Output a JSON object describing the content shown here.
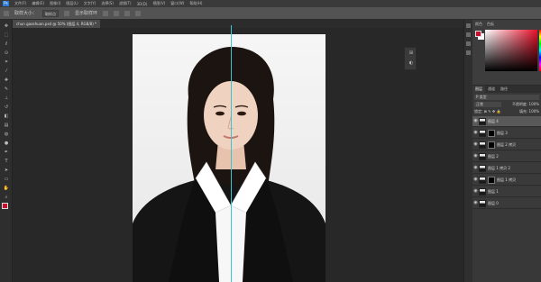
{
  "menu": {
    "logo": "Ps",
    "items": [
      "文件(F)",
      "编辑(E)",
      "图像(I)",
      "图层(L)",
      "文字(Y)",
      "选择(S)",
      "滤镜(T)",
      "3D(D)",
      "视图(V)",
      "窗口(W)",
      "帮助(H)"
    ]
  },
  "options": {
    "sample": "取样大小：",
    "sample_value": "取样点",
    "show_ring": "显示取样环"
  },
  "tabs": [
    {
      "label": "chun gaoshuan.psd @ 50% (图层 4, RGB/8) *",
      "active": true
    }
  ],
  "color_panel": {
    "tabs": [
      "颜色",
      "色板"
    ],
    "fg_color": "#c8102e",
    "bg_color": "#ffffff"
  },
  "layers_panel": {
    "tabs": [
      "图层",
      "通道",
      "路径"
    ],
    "filter": "P 类型",
    "blend_mode": "正常",
    "opacity": "不透明度: 100%",
    "lock": "锁定: ⊠ ✎ ✥ 🔒",
    "fill": "填充: 100%",
    "rows": [
      {
        "name": "图层 4",
        "mask": false,
        "active": true
      },
      {
        "name": "图层 3",
        "mask": true,
        "active": false
      },
      {
        "name": "图层 2 拷贝",
        "mask": true,
        "active": false
      },
      {
        "name": "图层 2",
        "mask": false,
        "active": false
      },
      {
        "name": "图层 1 拷贝 2",
        "mask": false,
        "active": false
      },
      {
        "name": "图层 1 拷贝",
        "mask": true,
        "active": false
      },
      {
        "name": "图层 1",
        "mask": false,
        "active": false
      },
      {
        "name": "图层 0",
        "mask": false,
        "active": false
      }
    ]
  }
}
